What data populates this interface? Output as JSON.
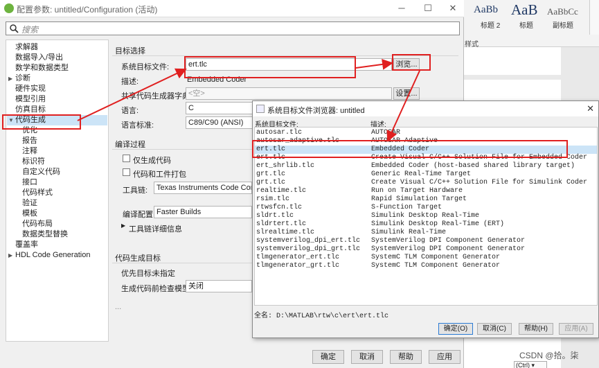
{
  "window": {
    "title": "配置参数: untitled/Configuration (活动)",
    "minimize": "─",
    "maximize": "☐",
    "close": "✕"
  },
  "search": {
    "placeholder": "搜索"
  },
  "tree": {
    "items": [
      {
        "label": "求解器"
      },
      {
        "label": "数据导入/导出"
      },
      {
        "label": "数学和数据类型"
      },
      {
        "label": "诊断"
      },
      {
        "label": "硬件实现"
      },
      {
        "label": "模型引用"
      },
      {
        "label": "仿真目标"
      },
      {
        "label": "代码生成"
      },
      {
        "label": "优化"
      },
      {
        "label": "报告"
      },
      {
        "label": "注释"
      },
      {
        "label": "标识符"
      },
      {
        "label": "自定义代码"
      },
      {
        "label": "接口"
      },
      {
        "label": "代码样式"
      },
      {
        "label": "验证"
      },
      {
        "label": "模板"
      },
      {
        "label": "代码布局"
      },
      {
        "label": "数据类型替换"
      },
      {
        "label": "覆盖率"
      },
      {
        "label": "HDL Code Generation"
      }
    ]
  },
  "target": {
    "section": "目标选择",
    "system_target_label": "系统目标文件:",
    "system_target_value": "ert.tlc",
    "browse_label": "浏览...",
    "description_label": "描述:",
    "description_value": "Embedded Coder",
    "shared_dict_label": "共享代码生成器字典:",
    "shared_dict_value": "<空>",
    "settings_label": "设置...",
    "language_label": "语言:",
    "language_value": "C",
    "standard_label": "语言标准:",
    "standard_value": "C89/C90 (ANSI)"
  },
  "build": {
    "section": "编译过程",
    "gen_only": "仅生成代码",
    "package": "代码和工件打包",
    "toolchain_label": "工具链:",
    "toolchain_value": "Texas Instruments Code Compo",
    "config_label": "编译配置:",
    "config_value": "Faster Builds",
    "details_label": "工具链详细信息"
  },
  "codegen_target": {
    "section": "代码生成目标",
    "priority_label": "优先目标:",
    "priority_value": "未指定",
    "check_label": "生成代码前检查模型:",
    "check_value": "关闭",
    "ellipsis": "..."
  },
  "bottom_buttons": {
    "ok": "确定",
    "cancel": "取消",
    "help": "帮助",
    "apply": "应用"
  },
  "word": {
    "styles": [
      {
        "sample": "AaBb",
        "name": "标题 2"
      },
      {
        "sample": "AaB",
        "name": "标题"
      },
      {
        "sample": "AaBbCc",
        "name": "副标题"
      }
    ],
    "group": "样式",
    "watermark": "CSDN @拾。柒",
    "ctrl_tag": "(Ctrl) ▾"
  },
  "dialog": {
    "title": "系统目标文件浏览器: untitled",
    "col_file": "系统目标文件:",
    "col_desc": "描述:",
    "files": [
      {
        "name": "autosar.tlc",
        "desc": "AUTOSAR"
      },
      {
        "name": "autosar_adaptive.tlc",
        "desc": "AUTOSAR Adaptive"
      },
      {
        "name": "ert.tlc",
        "desc": "Embedded Coder"
      },
      {
        "name": "ert.tlc",
        "desc": "Create Visual C/C++ Solution File for Embedded Coder"
      },
      {
        "name": "ert_shrlib.tlc",
        "desc": "Embedded Coder (host-based shared library target)"
      },
      {
        "name": "grt.tlc",
        "desc": "Generic Real-Time Target"
      },
      {
        "name": "grt.tlc",
        "desc": "Create Visual C/C++ Solution File for Simulink Coder"
      },
      {
        "name": "realtime.tlc",
        "desc": "Run on Target Hardware"
      },
      {
        "name": "rsim.tlc",
        "desc": "Rapid Simulation Target"
      },
      {
        "name": "rtwsfcn.tlc",
        "desc": "S-Function Target"
      },
      {
        "name": "sldrt.tlc",
        "desc": "Simulink Desktop Real-Time"
      },
      {
        "name": "sldrtert.tlc",
        "desc": "Simulink Desktop Real-Time (ERT)"
      },
      {
        "name": "slrealtime.tlc",
        "desc": "Simulink Real-Time"
      },
      {
        "name": "systemverilog_dpi_ert.tlc",
        "desc": "SystemVerilog DPI Component Generator"
      },
      {
        "name": "systemverilog_dpi_grt.tlc",
        "desc": "SystemVerilog DPI Component Generator"
      },
      {
        "name": "tlmgenerator_ert.tlc",
        "desc": "SystemC TLM Component Generator"
      },
      {
        "name": "tlmgenerator_grt.tlc",
        "desc": "SystemC TLM Component Generator"
      }
    ],
    "fullname": "全名: D:\\MATLAB\\rtw\\c\\ert\\ert.tlc",
    "buttons": {
      "ok": "确定(O)",
      "cancel": "取消(C)",
      "help": "帮助(H)",
      "apply": "应用(A)"
    },
    "close": "✕"
  },
  "colors": {
    "annotation": "#e02020",
    "selection": "#cce4f7"
  }
}
